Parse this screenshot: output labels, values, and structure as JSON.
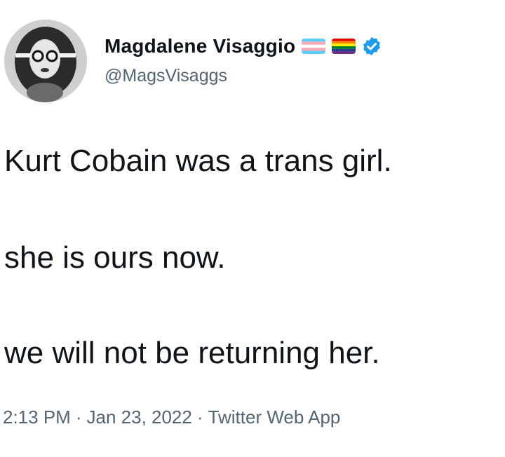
{
  "user": {
    "display_name": "Magdalene Visaggio",
    "handle": "@MagsVisaggs",
    "badges": [
      "transgender-flag-icon",
      "rainbow-flag-icon",
      "verified-badge-icon"
    ]
  },
  "tweet": {
    "lines": [
      "Kurt Cobain was a trans girl.",
      "she is ours now.",
      "we will not be returning her."
    ],
    "time": "2:13 PM",
    "date": "Jan 23, 2022",
    "source": "Twitter Web App",
    "separator": "·"
  },
  "colors": {
    "text": "#0f1419",
    "secondary": "#536471",
    "verified": "#1d9bf0",
    "trans_blue": "#5bcefa",
    "trans_pink": "#f5a9b8"
  }
}
